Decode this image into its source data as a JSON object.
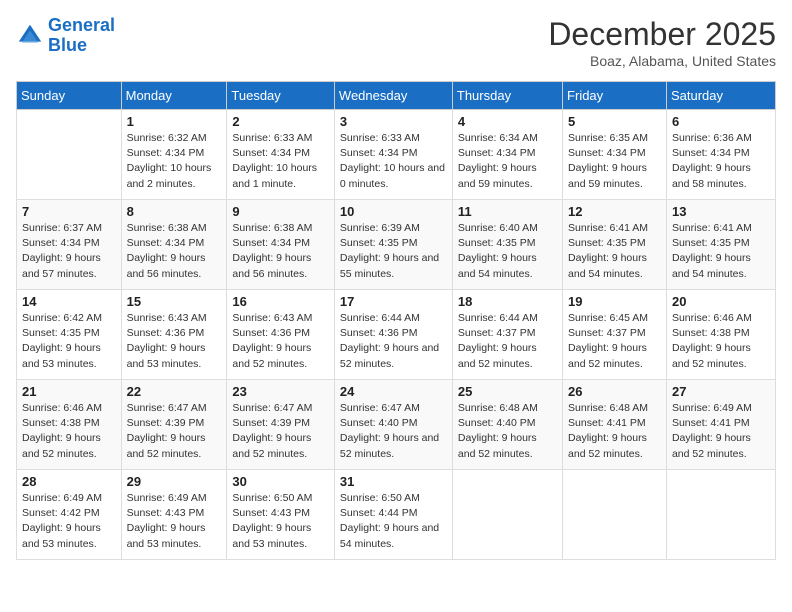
{
  "logo": {
    "line1": "General",
    "line2": "Blue"
  },
  "title": "December 2025",
  "location": "Boaz, Alabama, United States",
  "days_of_week": [
    "Sunday",
    "Monday",
    "Tuesday",
    "Wednesday",
    "Thursday",
    "Friday",
    "Saturday"
  ],
  "weeks": [
    [
      {
        "num": "",
        "sunrise": "",
        "sunset": "",
        "daylight": ""
      },
      {
        "num": "1",
        "sunrise": "Sunrise: 6:32 AM",
        "sunset": "Sunset: 4:34 PM",
        "daylight": "Daylight: 10 hours and 2 minutes."
      },
      {
        "num": "2",
        "sunrise": "Sunrise: 6:33 AM",
        "sunset": "Sunset: 4:34 PM",
        "daylight": "Daylight: 10 hours and 1 minute."
      },
      {
        "num": "3",
        "sunrise": "Sunrise: 6:33 AM",
        "sunset": "Sunset: 4:34 PM",
        "daylight": "Daylight: 10 hours and 0 minutes."
      },
      {
        "num": "4",
        "sunrise": "Sunrise: 6:34 AM",
        "sunset": "Sunset: 4:34 PM",
        "daylight": "Daylight: 9 hours and 59 minutes."
      },
      {
        "num": "5",
        "sunrise": "Sunrise: 6:35 AM",
        "sunset": "Sunset: 4:34 PM",
        "daylight": "Daylight: 9 hours and 59 minutes."
      },
      {
        "num": "6",
        "sunrise": "Sunrise: 6:36 AM",
        "sunset": "Sunset: 4:34 PM",
        "daylight": "Daylight: 9 hours and 58 minutes."
      }
    ],
    [
      {
        "num": "7",
        "sunrise": "Sunrise: 6:37 AM",
        "sunset": "Sunset: 4:34 PM",
        "daylight": "Daylight: 9 hours and 57 minutes."
      },
      {
        "num": "8",
        "sunrise": "Sunrise: 6:38 AM",
        "sunset": "Sunset: 4:34 PM",
        "daylight": "Daylight: 9 hours and 56 minutes."
      },
      {
        "num": "9",
        "sunrise": "Sunrise: 6:38 AM",
        "sunset": "Sunset: 4:34 PM",
        "daylight": "Daylight: 9 hours and 56 minutes."
      },
      {
        "num": "10",
        "sunrise": "Sunrise: 6:39 AM",
        "sunset": "Sunset: 4:35 PM",
        "daylight": "Daylight: 9 hours and 55 minutes."
      },
      {
        "num": "11",
        "sunrise": "Sunrise: 6:40 AM",
        "sunset": "Sunset: 4:35 PM",
        "daylight": "Daylight: 9 hours and 54 minutes."
      },
      {
        "num": "12",
        "sunrise": "Sunrise: 6:41 AM",
        "sunset": "Sunset: 4:35 PM",
        "daylight": "Daylight: 9 hours and 54 minutes."
      },
      {
        "num": "13",
        "sunrise": "Sunrise: 6:41 AM",
        "sunset": "Sunset: 4:35 PM",
        "daylight": "Daylight: 9 hours and 54 minutes."
      }
    ],
    [
      {
        "num": "14",
        "sunrise": "Sunrise: 6:42 AM",
        "sunset": "Sunset: 4:35 PM",
        "daylight": "Daylight: 9 hours and 53 minutes."
      },
      {
        "num": "15",
        "sunrise": "Sunrise: 6:43 AM",
        "sunset": "Sunset: 4:36 PM",
        "daylight": "Daylight: 9 hours and 53 minutes."
      },
      {
        "num": "16",
        "sunrise": "Sunrise: 6:43 AM",
        "sunset": "Sunset: 4:36 PM",
        "daylight": "Daylight: 9 hours and 52 minutes."
      },
      {
        "num": "17",
        "sunrise": "Sunrise: 6:44 AM",
        "sunset": "Sunset: 4:36 PM",
        "daylight": "Daylight: 9 hours and 52 minutes."
      },
      {
        "num": "18",
        "sunrise": "Sunrise: 6:44 AM",
        "sunset": "Sunset: 4:37 PM",
        "daylight": "Daylight: 9 hours and 52 minutes."
      },
      {
        "num": "19",
        "sunrise": "Sunrise: 6:45 AM",
        "sunset": "Sunset: 4:37 PM",
        "daylight": "Daylight: 9 hours and 52 minutes."
      },
      {
        "num": "20",
        "sunrise": "Sunrise: 6:46 AM",
        "sunset": "Sunset: 4:38 PM",
        "daylight": "Daylight: 9 hours and 52 minutes."
      }
    ],
    [
      {
        "num": "21",
        "sunrise": "Sunrise: 6:46 AM",
        "sunset": "Sunset: 4:38 PM",
        "daylight": "Daylight: 9 hours and 52 minutes."
      },
      {
        "num": "22",
        "sunrise": "Sunrise: 6:47 AM",
        "sunset": "Sunset: 4:39 PM",
        "daylight": "Daylight: 9 hours and 52 minutes."
      },
      {
        "num": "23",
        "sunrise": "Sunrise: 6:47 AM",
        "sunset": "Sunset: 4:39 PM",
        "daylight": "Daylight: 9 hours and 52 minutes."
      },
      {
        "num": "24",
        "sunrise": "Sunrise: 6:47 AM",
        "sunset": "Sunset: 4:40 PM",
        "daylight": "Daylight: 9 hours and 52 minutes."
      },
      {
        "num": "25",
        "sunrise": "Sunrise: 6:48 AM",
        "sunset": "Sunset: 4:40 PM",
        "daylight": "Daylight: 9 hours and 52 minutes."
      },
      {
        "num": "26",
        "sunrise": "Sunrise: 6:48 AM",
        "sunset": "Sunset: 4:41 PM",
        "daylight": "Daylight: 9 hours and 52 minutes."
      },
      {
        "num": "27",
        "sunrise": "Sunrise: 6:49 AM",
        "sunset": "Sunset: 4:41 PM",
        "daylight": "Daylight: 9 hours and 52 minutes."
      }
    ],
    [
      {
        "num": "28",
        "sunrise": "Sunrise: 6:49 AM",
        "sunset": "Sunset: 4:42 PM",
        "daylight": "Daylight: 9 hours and 53 minutes."
      },
      {
        "num": "29",
        "sunrise": "Sunrise: 6:49 AM",
        "sunset": "Sunset: 4:43 PM",
        "daylight": "Daylight: 9 hours and 53 minutes."
      },
      {
        "num": "30",
        "sunrise": "Sunrise: 6:50 AM",
        "sunset": "Sunset: 4:43 PM",
        "daylight": "Daylight: 9 hours and 53 minutes."
      },
      {
        "num": "31",
        "sunrise": "Sunrise: 6:50 AM",
        "sunset": "Sunset: 4:44 PM",
        "daylight": "Daylight: 9 hours and 54 minutes."
      },
      {
        "num": "",
        "sunrise": "",
        "sunset": "",
        "daylight": ""
      },
      {
        "num": "",
        "sunrise": "",
        "sunset": "",
        "daylight": ""
      },
      {
        "num": "",
        "sunrise": "",
        "sunset": "",
        "daylight": ""
      }
    ]
  ]
}
